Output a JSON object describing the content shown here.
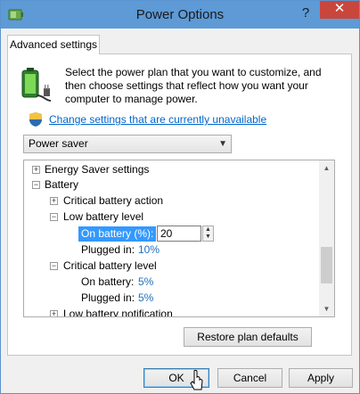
{
  "window": {
    "title": "Power Options",
    "help_glyph": "?",
    "close_glyph": "✕"
  },
  "tabs": [
    {
      "label": "Advanced settings",
      "active": true
    }
  ],
  "description": "Select the power plan that you want to customize, and then choose settings that reflect how you want your computer to manage power.",
  "change_link": "Change settings that are currently unavailable",
  "plan_select": {
    "value": "Power saver"
  },
  "tree": {
    "items": [
      {
        "expander": "+",
        "label": "Energy Saver settings"
      },
      {
        "expander": "−",
        "label": "Battery"
      },
      {
        "expander": "+",
        "label": "Critical battery action"
      },
      {
        "expander": "−",
        "label": "Low battery level"
      },
      {
        "label": "On battery (%):",
        "input_value": "20",
        "selected": true
      },
      {
        "label": "Plugged in:",
        "value": "10%"
      },
      {
        "expander": "−",
        "label": "Critical battery level"
      },
      {
        "label": "On battery:",
        "value": "5%"
      },
      {
        "label": "Plugged in:",
        "value": "5%"
      },
      {
        "expander": "+",
        "label": "Low battery notification"
      }
    ]
  },
  "buttons": {
    "restore": "Restore plan defaults",
    "ok": "OK",
    "cancel": "Cancel",
    "apply": "Apply"
  },
  "colors": {
    "titlebar": "#5d9ad6",
    "close_button": "#c9463d",
    "link": "#0066cc",
    "selection": "#3399ff",
    "value_text": "#1f6fbf"
  },
  "icons": {
    "title": "power-options-icon",
    "battery": "battery-plug-icon",
    "shield": "uac-shield-icon",
    "cursor": "mouse-pointer-icon"
  }
}
